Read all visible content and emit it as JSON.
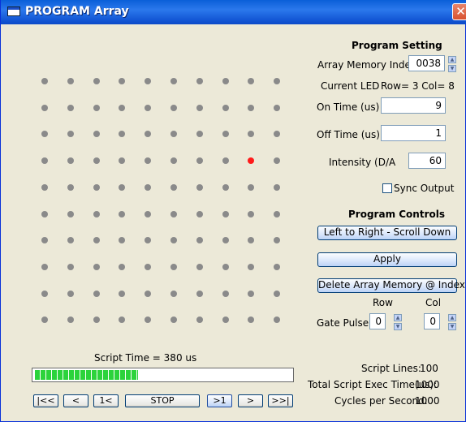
{
  "window": {
    "title": "PROGRAM Array"
  },
  "led_grid": {
    "rows": 10,
    "cols": 10,
    "active": {
      "row": 3,
      "col": 8
    }
  },
  "program_setting": {
    "heading": "Program Setting",
    "memory_index_label": "Array Memory Index",
    "memory_index_value": "0038",
    "current_led_label": "Current LED",
    "current_led_value": "Row= 3  Col= 8",
    "on_time_label": "On Time (us)",
    "on_time_value": "9",
    "off_time_label": "Off Time (us)",
    "off_time_value": "1",
    "intensity_label": "Intensity (D/A",
    "intensity_value": "60",
    "sync_output_label": "Sync Output",
    "sync_output_checked": false
  },
  "program_controls": {
    "heading": "Program Controls",
    "scroll_button": "Left to Right - Scroll Down",
    "apply_button": "Apply",
    "delete_button": "Delete Array Memory @ Index",
    "row_label": "Row",
    "col_label": "Col",
    "gate_pulse_label": "Gate Pulse",
    "gate_row_value": "0",
    "gate_col_value": "0"
  },
  "script": {
    "time_label": "Script Time =  380 us",
    "progress": 0.4,
    "lines_label": "Script Lines:",
    "lines_value": "100",
    "exec_label": "Total Script Exec Time(us):",
    "exec_value": "1000",
    "cycles_label": "Cycles per Second:",
    "cycles_value": "1000"
  },
  "nav_buttons": [
    "|<<",
    "<",
    "1<",
    "STOP",
    ">1",
    ">",
    ">>|"
  ],
  "colors": {
    "active_led": "#ff1a1a",
    "idle_led": "#8a8a8a",
    "progress": "#2bd33b"
  }
}
